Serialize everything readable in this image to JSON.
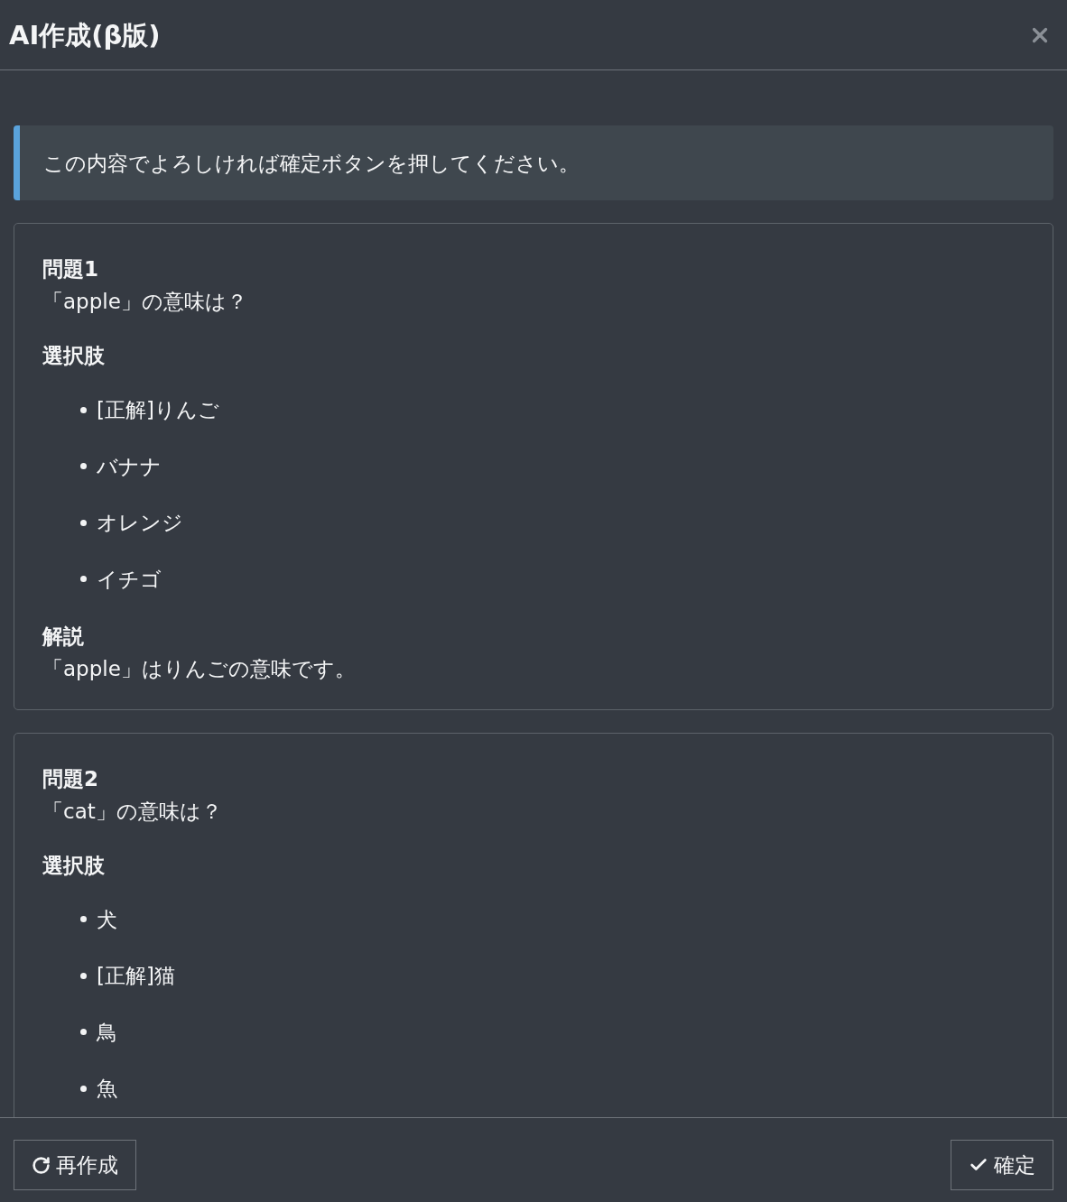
{
  "dialog": {
    "title": "AI作成(β版)"
  },
  "alert": {
    "message": "この内容でよろしければ確定ボタンを押してください。"
  },
  "questions": [
    {
      "heading": "問題1",
      "text": "「apple」の意味は？",
      "choices_label": "選択肢",
      "choices": [
        "[正解]りんご",
        "バナナ",
        "オレンジ",
        "イチゴ"
      ],
      "explanation_label": "解説",
      "explanation": "「apple」はりんごの意味です。"
    },
    {
      "heading": "問題2",
      "text": "「cat」の意味は？",
      "choices_label": "選択肢",
      "choices": [
        "犬",
        "[正解]猫",
        "鳥",
        "魚"
      ]
    }
  ],
  "footer": {
    "buttons": [
      {
        "label": "再作成",
        "kind": "regenerate"
      },
      {
        "label": "確定",
        "kind": "confirm"
      }
    ]
  }
}
